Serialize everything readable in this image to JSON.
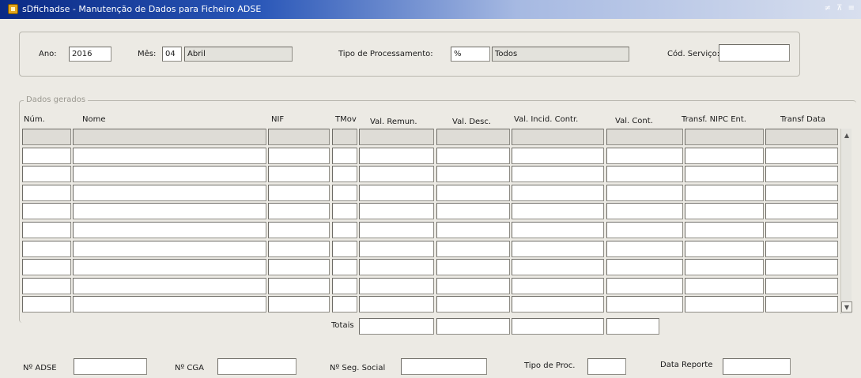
{
  "window": {
    "title": "sDfichadse - Manutenção de Dados para Ficheiro ADSE",
    "controls": "≠ ⊼ ≡"
  },
  "filters": {
    "ano_label": "Ano:",
    "ano_value": "2016",
    "mes_label": "Mês:",
    "mes_value": "04",
    "mes_name": "Abril",
    "tipo_label": "Tipo de Processamento:",
    "tipo_value": "%",
    "tipo_name": "Todos",
    "cod_servico_label": "Cód. Serviço:",
    "cod_servico_value": ""
  },
  "dados": {
    "legend": "Dados gerados",
    "columns": [
      "Núm.",
      "Nome",
      "NIF",
      "TMov",
      "Val. Remun.",
      "Val. Desc.",
      "Val. Incid. Contr.",
      "Val. Cont.",
      "Transf. NIPC Ent.",
      "Transf Data"
    ],
    "totais_label": "Totais"
  },
  "footer": {
    "adse_label": "Nº ADSE",
    "cga_label": "Nº CGA",
    "seg_social_label": "Nº Seg. Social",
    "tipo_proc_label": "Tipo de Proc.",
    "data_reporte_label": "Data Reporte"
  }
}
